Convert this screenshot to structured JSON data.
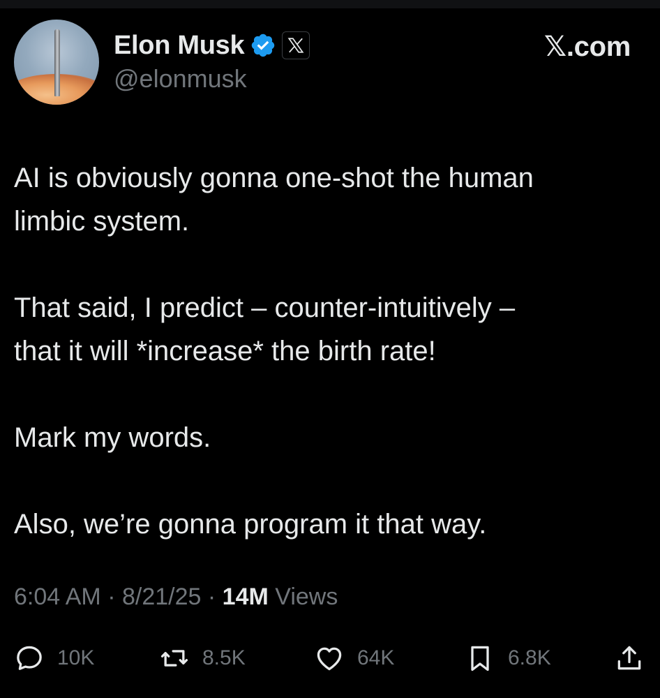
{
  "author": {
    "display_name": "Elon Musk",
    "handle": "@elonmusk",
    "verified": true,
    "avatar_icon": "rocket-launch-avatar"
  },
  "brand": "𝕏.com",
  "tweet": {
    "paragraphs": [
      "AI is obviously gonna one-shot the human\nlimbic system.",
      "That said, I predict – counter-intuitively –\nthat it will *increase* the birth rate!",
      "Mark my words.",
      "Also, we’re gonna program it that way."
    ]
  },
  "meta": {
    "time": "6:04 AM",
    "separator": "·",
    "date": "8/21/25",
    "views_count": "14M",
    "views_label": "Views"
  },
  "actions": {
    "replies": "10K",
    "reposts": "8.5K",
    "likes": "64K",
    "bookmarks": "6.8K"
  },
  "colors": {
    "background": "#000000",
    "text": "#e7e9ea",
    "muted": "#71767b",
    "verified_blue": "#1d9bf0"
  }
}
